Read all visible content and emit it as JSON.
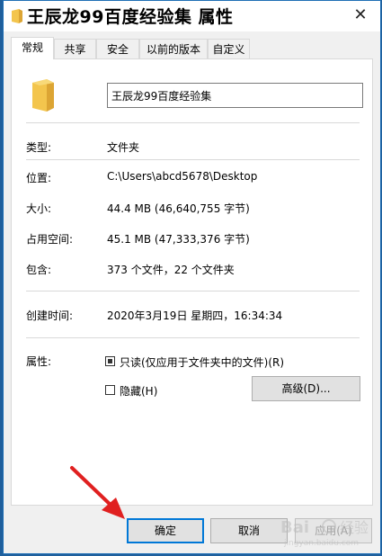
{
  "window": {
    "title": "王辰龙99百度经验集 属性",
    "close_label": "✕"
  },
  "tabs": [
    {
      "label": "常规",
      "active": true
    },
    {
      "label": "共享"
    },
    {
      "label": "安全"
    },
    {
      "label": "以前的版本"
    },
    {
      "label": "自定义"
    }
  ],
  "general": {
    "folder_name": "王辰龙99百度经验集",
    "type_label": "类型:",
    "type_value": "文件夹",
    "location_label": "位置:",
    "location_value": "C:\\Users\\abcd5678\\Desktop",
    "size_label": "大小:",
    "size_value": "44.4 MB (46,640,755 字节)",
    "disk_size_label": "占用空间:",
    "disk_size_value": "45.1 MB (47,333,376 字节)",
    "contains_label": "包含:",
    "contains_value": "373 个文件，22 个文件夹",
    "created_label": "创建时间:",
    "created_value": "2020年3月19日 星期四，16:34:34",
    "attributes_label": "属性:",
    "readonly_label": "只读(仅应用于文件夹中的文件)(R)",
    "readonly_checked": true,
    "hidden_label": "隐藏(H)",
    "hidden_checked": false,
    "advanced_label": "高级(D)..."
  },
  "footer": {
    "ok_label": "确定",
    "cancel_label": "取消",
    "apply_label": "应用(A)"
  },
  "colors": {
    "accent": "#0078d7",
    "arrow": "#e02020",
    "folder": "#f3c54d"
  }
}
